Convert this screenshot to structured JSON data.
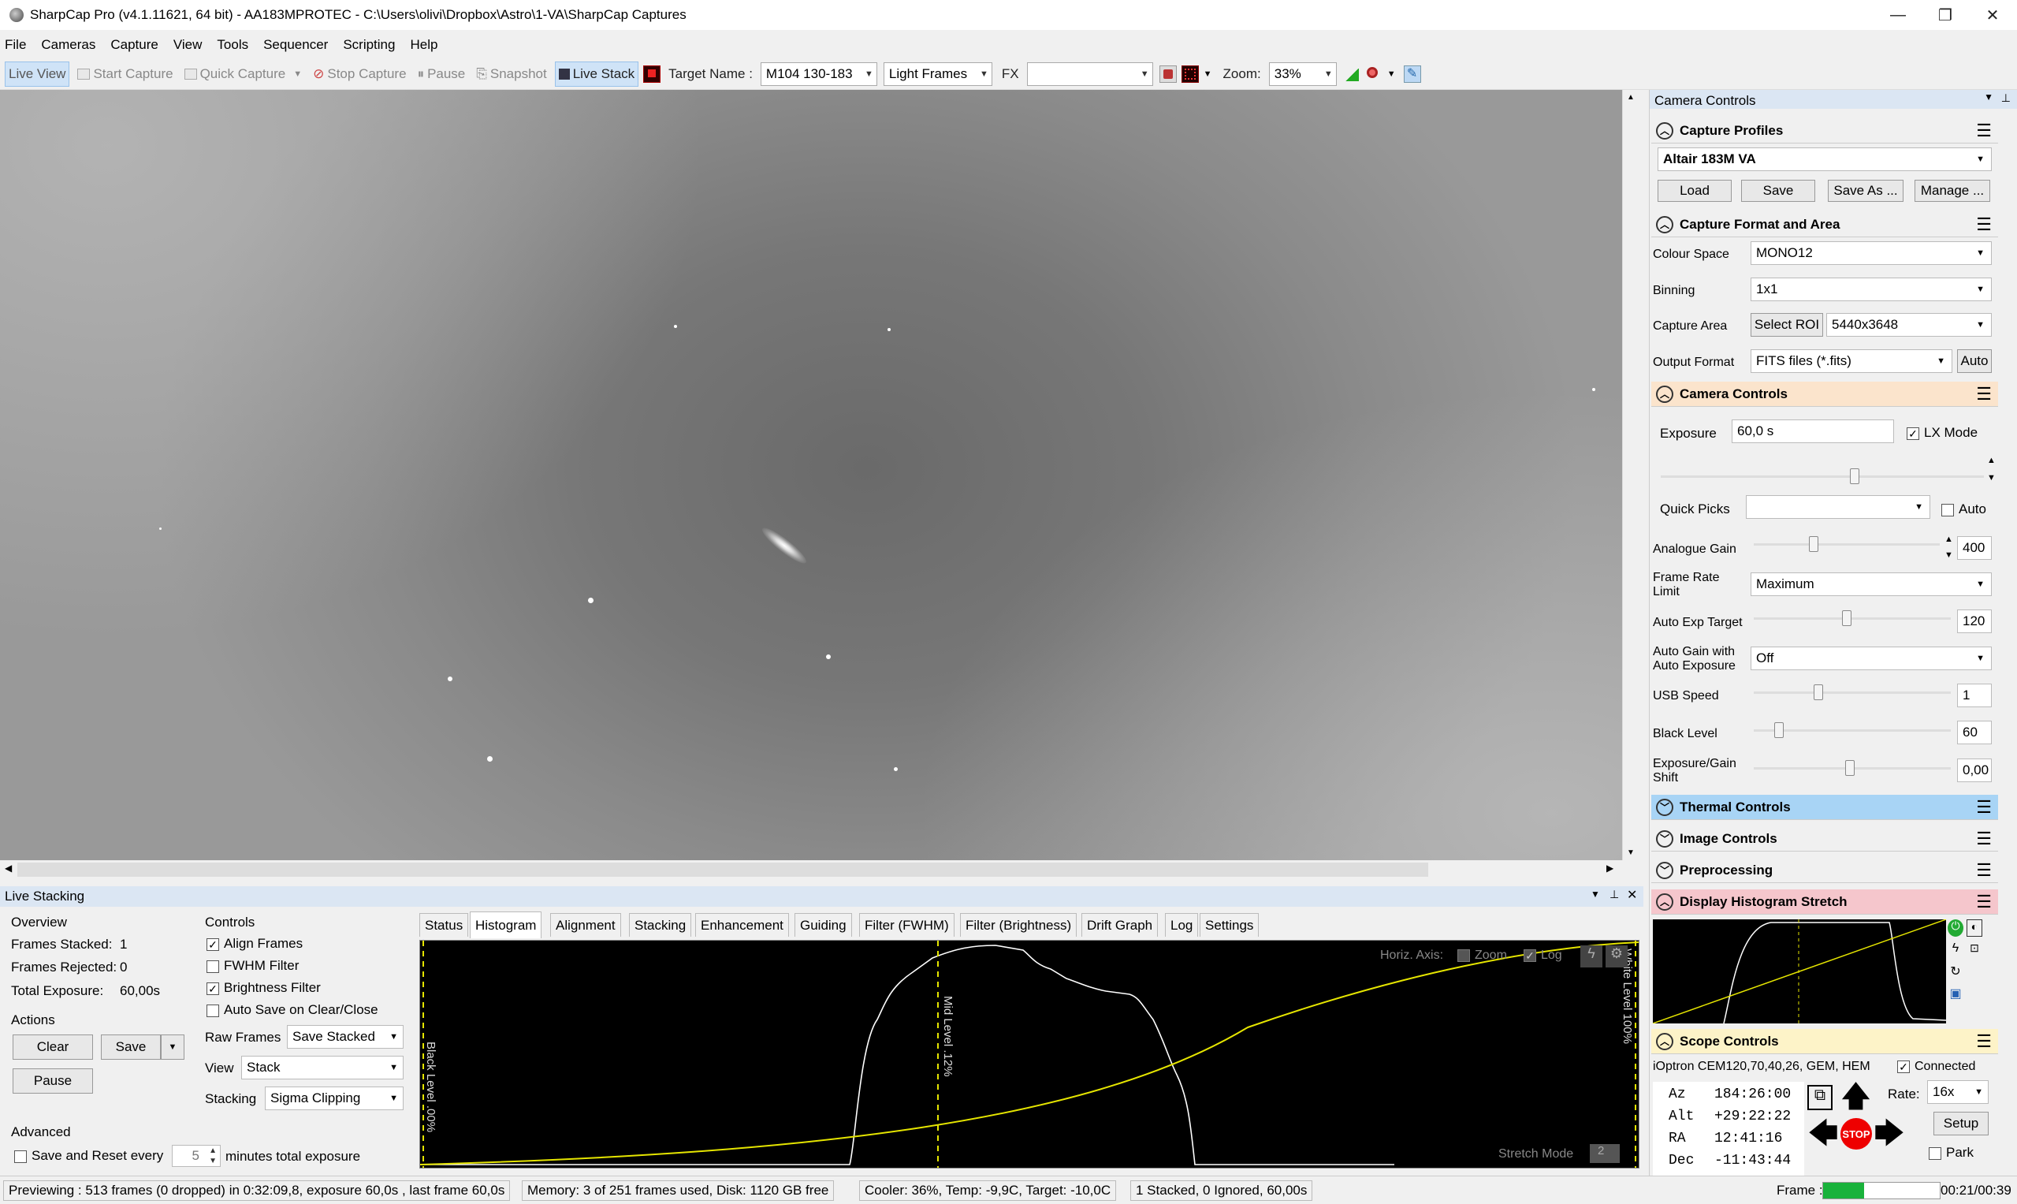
{
  "window": {
    "title": "SharpCap Pro (v4.1.11621, 64 bit) - AA183MPROTEC - C:\\Users\\olivi\\Dropbox\\Astro\\1-VA\\SharpCap Captures"
  },
  "menu": [
    "File",
    "Cameras",
    "Capture",
    "View",
    "Tools",
    "Sequencer",
    "Scripting",
    "Help"
  ],
  "toolbar": {
    "live_view": "Live View",
    "start_capture": "Start Capture",
    "quick_capture": "Quick Capture",
    "stop_capture": "Stop Capture",
    "pause": "Pause",
    "snapshot": "Snapshot",
    "live_stack": "Live Stack",
    "target_name_label": "Target Name :",
    "target_name_value": "M104 130-183",
    "frame_type": "Light Frames",
    "fx_label": "FX",
    "fx_value": "",
    "zoom_label": "Zoom:",
    "zoom_value": "33%"
  },
  "camera_controls": {
    "panel_title": "Camera Controls",
    "capture_profiles": {
      "title": "Capture Profiles",
      "profile": "Altair 183M VA",
      "buttons": [
        "Load",
        "Save",
        "Save As ...",
        "Manage ..."
      ]
    },
    "capture_format": {
      "title": "Capture Format and Area",
      "colour_space_label": "Colour Space",
      "colour_space": "MONO12",
      "binning_label": "Binning",
      "binning": "1x1",
      "capture_area_label": "Capture Area",
      "select_roi": "Select ROI",
      "capture_area": "5440x3648",
      "output_format_label": "Output Format",
      "output_format": "FITS files (*.fits)",
      "auto": "Auto"
    },
    "camera_controls": {
      "title": "Camera Controls",
      "exposure_label": "Exposure",
      "exposure": "60,0 s",
      "lx_mode": "LX Mode",
      "quick_picks_label": "Quick Picks",
      "quick_picks_auto": "Auto",
      "analogue_gain_label": "Analogue Gain",
      "analogue_gain": "400",
      "frame_rate_label": "Frame Rate Limit",
      "frame_rate": "Maximum",
      "auto_exp_target_label": "Auto Exp Target",
      "auto_exp_target": "120",
      "auto_gain_label": "Auto Gain with Auto Exposure",
      "auto_gain": "Off",
      "usb_speed_label": "USB Speed",
      "usb_speed": "1",
      "black_level_label": "Black Level",
      "black_level": "60",
      "exp_gain_shift_label": "Exposure/Gain Shift",
      "exp_gain_shift": "0,00"
    },
    "thermal": "Thermal Controls",
    "image": "Image Controls",
    "preprocessing": "Preprocessing",
    "display_histogram": "Display Histogram Stretch",
    "scope": {
      "title": "Scope Controls",
      "mount": "iOptron CEM120,70,40,26, GEM, HEM",
      "connected": "Connected",
      "az_label": "Az",
      "az": "184:26:00",
      "alt_label": "Alt",
      "alt": "+29:22:22",
      "ra_label": "RA",
      "ra": "12:41:16",
      "dec_label": "Dec",
      "dec": "-11:43:44",
      "rate_label": "Rate:",
      "rate": "16x",
      "setup": "Setup",
      "park": "Park",
      "stop": "STOP"
    }
  },
  "live_stacking": {
    "title": "Live Stacking",
    "overview_label": "Overview",
    "frames_stacked_label": "Frames Stacked:",
    "frames_stacked": "1",
    "frames_rejected_label": "Frames Rejected:",
    "frames_rejected": "0",
    "total_exposure_label": "Total Exposure:",
    "total_exposure": "60,00s",
    "actions_label": "Actions",
    "clear": "Clear",
    "save": "Save",
    "pause": "Pause",
    "advanced_label": "Advanced",
    "save_reset_label": "Save and Reset every",
    "save_reset_value": "5",
    "save_reset_suffix": "minutes total exposure",
    "controls_label": "Controls",
    "align_frames": "Align Frames",
    "fwhm_filter": "FWHM Filter",
    "brightness_filter": "Brightness Filter",
    "auto_save": "Auto Save on Clear/Close",
    "raw_frames_label": "Raw Frames",
    "raw_frames": "Save Stacked",
    "view_label": "View",
    "view": "Stack",
    "stacking_label": "Stacking",
    "stacking": "Sigma Clipping",
    "tabs": [
      "Status",
      "Histogram",
      "Alignment",
      "Stacking",
      "Enhancement",
      "Guiding",
      "Filter (FWHM)",
      "Filter (Brightness)",
      "Drift Graph",
      "Log",
      "Settings"
    ],
    "histogram": {
      "horiz_axis_label": "Horiz. Axis:",
      "zoom": "Zoom",
      "log": "Log",
      "black_level": "Black Level .00%",
      "mid_level": "Mid Level .12%",
      "white_level": "White Level 100%",
      "stretch_mode_label": "Stretch Mode",
      "stretch_mode": "2"
    }
  },
  "status": {
    "previewing": "Previewing : 513 frames (0 dropped) in 0:32:09,8, exposure 60,0s , last frame 60,0s",
    "memory": "Memory: 3 of 251 frames used, Disk: 1120 GB free",
    "cooler": "Cooler: 36%, Temp: -9,9C, Target: -10,0C",
    "stacked": "1 Stacked, 0 Ignored, 60,00s",
    "frame_label": "Frame :",
    "frame_progress": 0.35,
    "time": "00:21/00:39"
  },
  "colors": {
    "accent": "#cfe3f7",
    "thermal": "#a8d4f5",
    "histogram_header": "#f5c6cc",
    "scope_header": "#fdf3c8",
    "green": "#19b23b",
    "curve": "#e5e500"
  }
}
